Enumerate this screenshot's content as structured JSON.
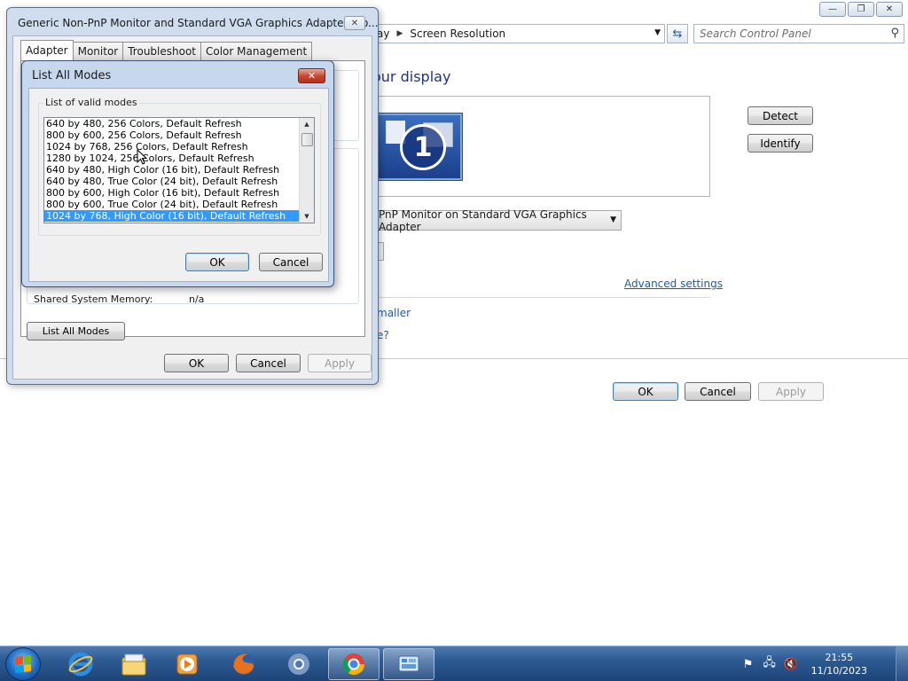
{
  "screen_resolution_window": {
    "breadcrumb": [
      "ay",
      "Screen Resolution"
    ],
    "search_placeholder": "Search Control Panel",
    "heading": "our display",
    "monitor_number": "1",
    "detect_label": "Detect",
    "identify_label": "Identify",
    "display_select_value": "PnP Monitor on Standard VGA Graphics Adapter",
    "advanced_settings_link": "Advanced settings",
    "link_smaller": "maller",
    "link_question": "e?",
    "ok_label": "OK",
    "cancel_label": "Cancel",
    "apply_label": "Apply"
  },
  "properties_dialog": {
    "title": "Generic Non-PnP Monitor and Standard VGA Graphics Adapter Pro...",
    "tabs": [
      "Adapter",
      "Monitor",
      "Troubleshoot",
      "Color Management"
    ],
    "active_tab": "Adapter",
    "shared_memory_label": "Shared System Memory:",
    "shared_memory_value": "n/a",
    "list_all_modes_label": "List All Modes",
    "ok_label": "OK",
    "cancel_label": "Cancel",
    "apply_label": "Apply"
  },
  "list_all_modes_dialog": {
    "title": "List All Modes",
    "group_label": "List of valid modes",
    "modes": [
      "640 by 480, 256 Colors, Default Refresh",
      "800 by 600, 256 Colors, Default Refresh",
      "1024 by 768, 256 Colors, Default Refresh",
      "1280 by 1024, 256 Colors, Default Refresh",
      "640 by 480, High Color (16 bit), Default Refresh",
      "640 by 480, True Color (24 bit), Default Refresh",
      "800 by 600, High Color (16 bit), Default Refresh",
      "800 by 600, True Color (24 bit), Default Refresh",
      "1024 by 768, High Color (16 bit), Default Refresh"
    ],
    "selected_mode": "1024 by 768, High Color (16 bit), Default Refresh",
    "ok_label": "OK",
    "cancel_label": "Cancel"
  },
  "taskbar": {
    "apps": [
      "internet-explorer-icon",
      "file-explorer-icon",
      "media-player-icon",
      "firefox-icon",
      "chromium-icon",
      "chrome-icon",
      "control-panel-icon"
    ],
    "active_app": "control-panel-icon",
    "clock_time": "21:55",
    "clock_date": "11/10/2023"
  },
  "colors": {
    "selection": "#3399ff",
    "link": "#1e5aa8",
    "heading": "#1e3287",
    "taskbar": "#2d5a93"
  }
}
